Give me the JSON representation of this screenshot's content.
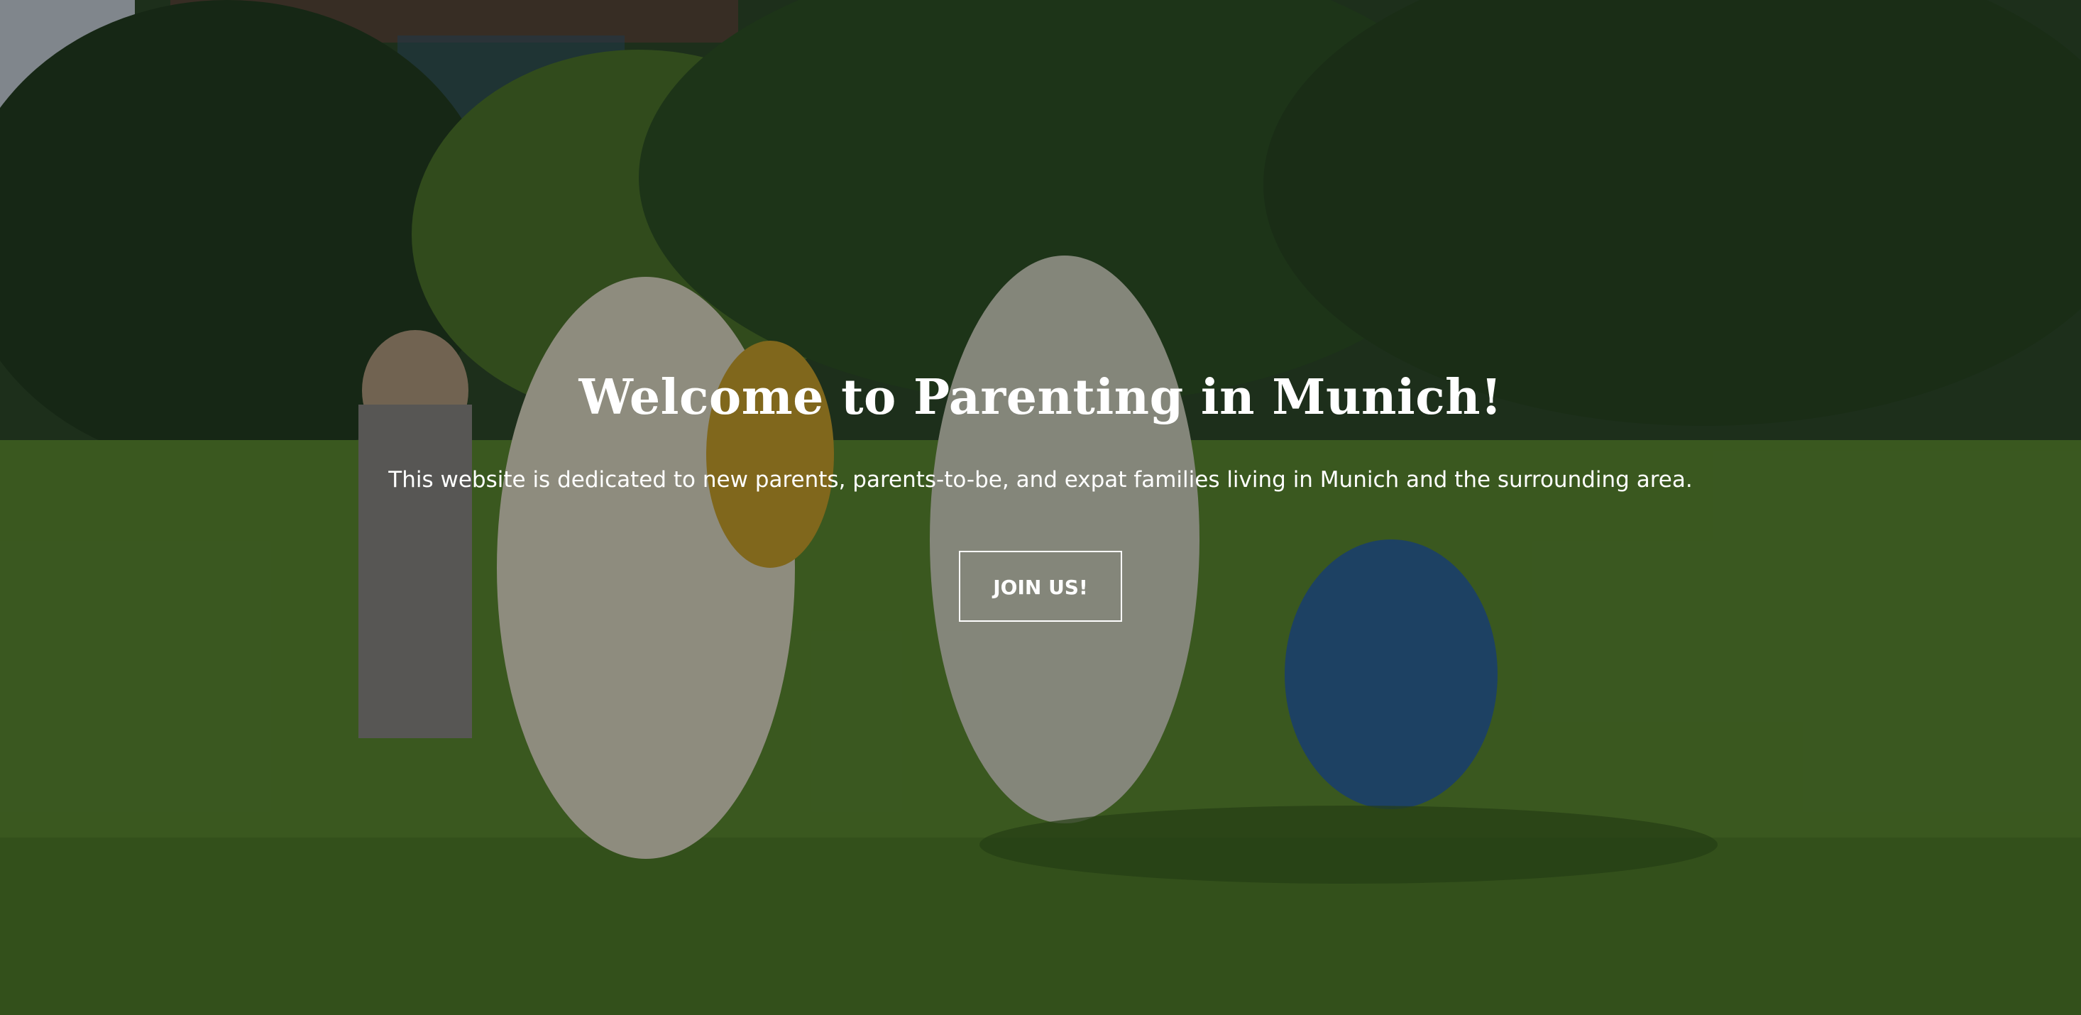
{
  "hero": {
    "title": "Welcome to Parenting in Munich!",
    "subtitle": "This website is dedicated to new parents, parents-to-be, and expat families living in Munich and the surrounding area.",
    "cta_label": "JOIN US!",
    "background_image": "children-playing-in-park-photo"
  },
  "colors": {
    "text": "#ffffff",
    "overlay": "#000000",
    "grass": "#5f8f34",
    "trees": "#2c4a2a"
  }
}
